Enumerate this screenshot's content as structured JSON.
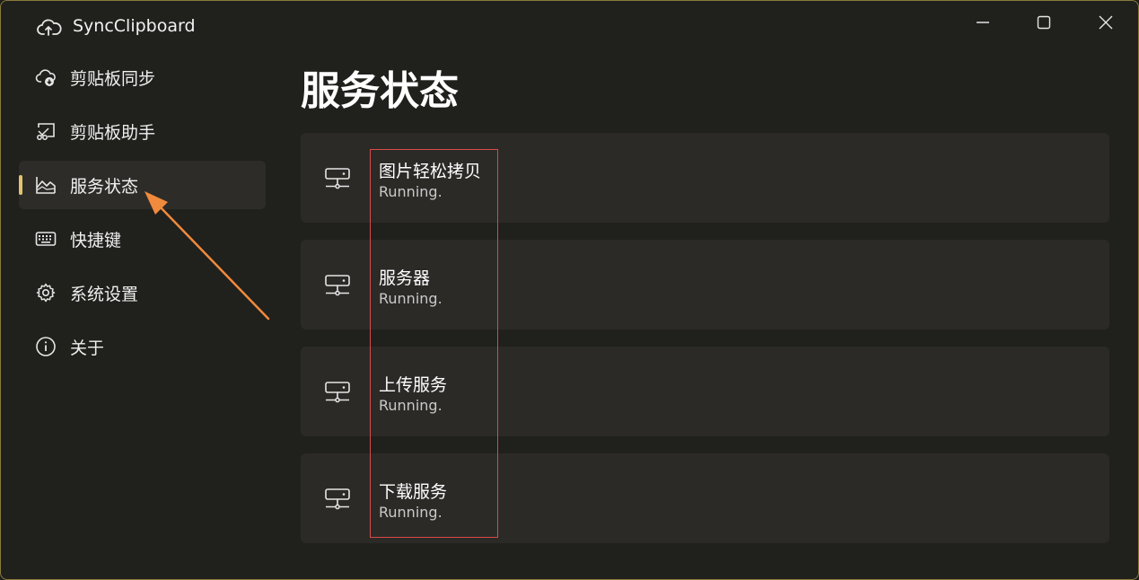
{
  "app": {
    "title": "SyncClipboard"
  },
  "window_controls": {
    "minimize": "minimize",
    "maximize": "maximize",
    "close": "close"
  },
  "sidebar": {
    "items": [
      {
        "label": "剪贴板同步",
        "icon": "cloud-sync-icon"
      },
      {
        "label": "剪贴板助手",
        "icon": "clipboard-cast-icon"
      },
      {
        "label": "服务状态",
        "icon": "area-chart-icon",
        "active": true
      },
      {
        "label": "快捷键",
        "icon": "keyboard-icon"
      },
      {
        "label": "系统设置",
        "icon": "gear-icon"
      },
      {
        "label": "关于",
        "icon": "info-icon"
      }
    ]
  },
  "main": {
    "title": "服务状态",
    "services": [
      {
        "name": "图片轻松拷贝",
        "status": "Running."
      },
      {
        "name": "服务器",
        "status": "Running."
      },
      {
        "name": "上传服务",
        "status": "Running."
      },
      {
        "name": "下载服务",
        "status": "Running."
      }
    ]
  },
  "colors": {
    "accent": "#e2c46e",
    "annotation_arrow": "#f08a3c",
    "annotation_box": "#d94a4a"
  }
}
